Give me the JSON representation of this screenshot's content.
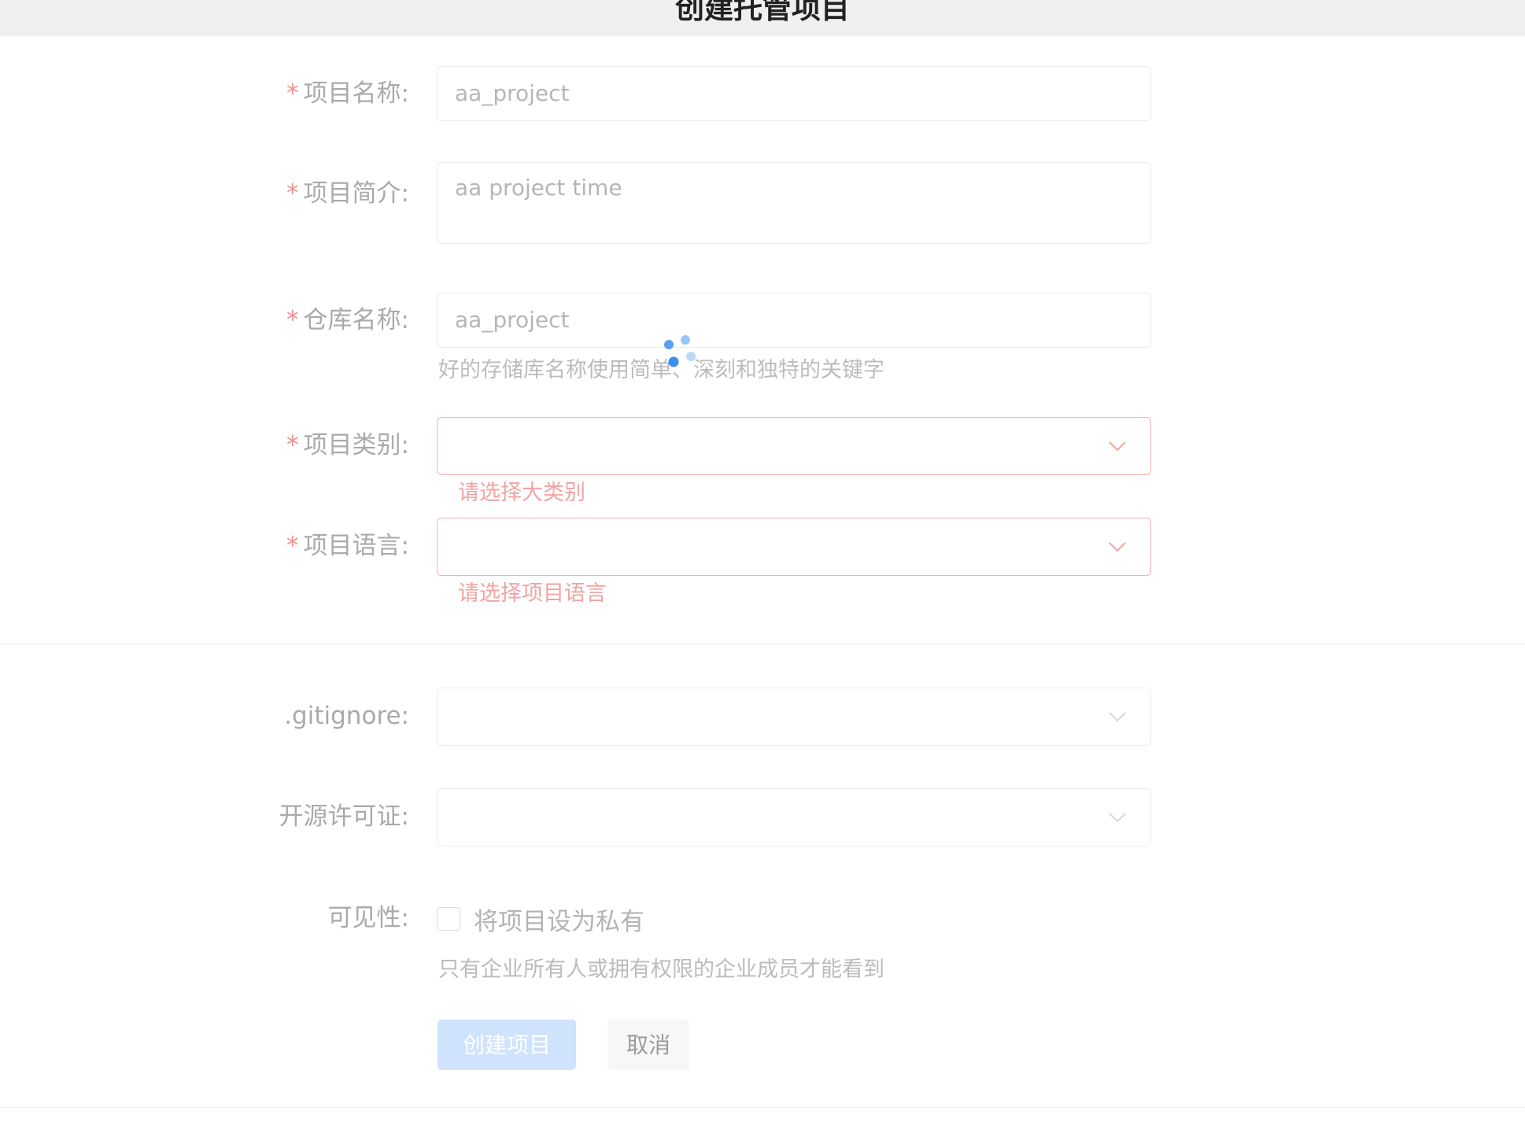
{
  "header": {
    "title": "创建托管项目"
  },
  "form": {
    "name": {
      "label": "项目名称:",
      "value": "aa_project"
    },
    "intro": {
      "label": "项目简介:",
      "value": "aa project time"
    },
    "repo": {
      "label": "仓库名称:",
      "value": "aa_project",
      "help": "好的存储库名称使用简单、深刻和独特的关键字"
    },
    "category": {
      "label": "项目类别:",
      "value": "",
      "error": "请选择大类别"
    },
    "language": {
      "label": "项目语言:",
      "value": "",
      "error": "请选择项目语言"
    },
    "gitignore": {
      "label": ".gitignore:",
      "value": ""
    },
    "license": {
      "label": "开源许可证:",
      "value": ""
    },
    "visibility": {
      "label": "可见性:",
      "checkbox_label": "将项目设为私有",
      "checked": false,
      "help": "只有企业所有人或拥有权限的企业成员才能看到"
    }
  },
  "required_mark": "*",
  "actions": {
    "create": "创建项目",
    "cancel": "取消"
  },
  "colors": {
    "error": "#f2a3a3",
    "primary_disabled": "#cfe3fc",
    "spinner": "#3d8df0"
  },
  "icons": {
    "dropdown": "chevron-down-icon",
    "loading": "loading-spinner-icon"
  }
}
